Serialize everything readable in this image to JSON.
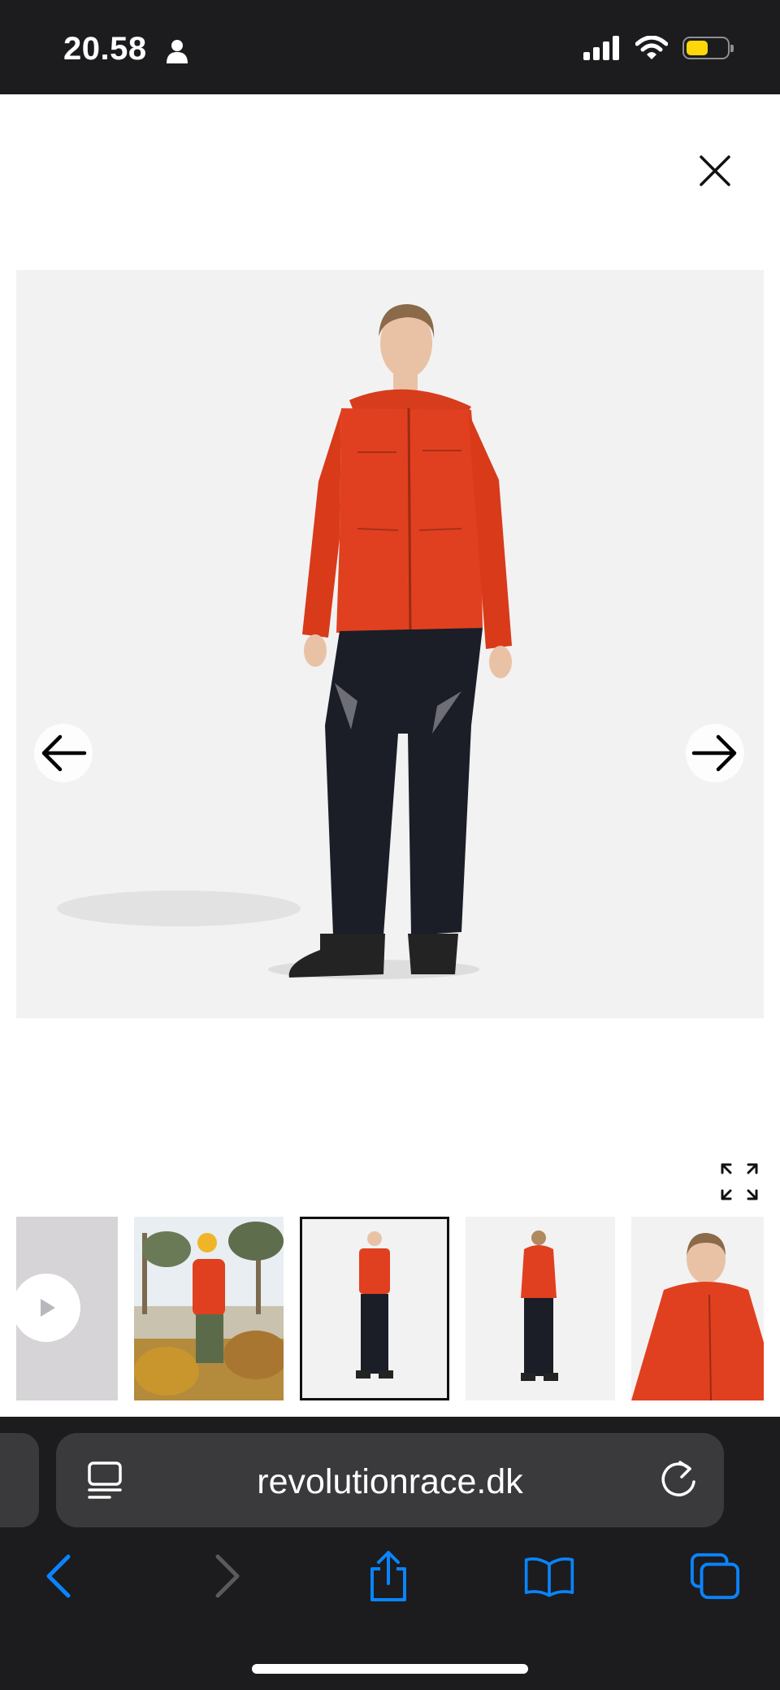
{
  "status_bar": {
    "time": "20.58",
    "icons": [
      "person-icon",
      "signal-icon",
      "wifi-icon",
      "battery-icon"
    ],
    "battery_color": "#ffd60a"
  },
  "gallery": {
    "close_icon": "close-icon",
    "prev_icon": "arrow-left-icon",
    "next_icon": "arrow-right-icon",
    "expand_icon": "expand-icon",
    "thumbnails": [
      {
        "kind": "video",
        "icon": "play-icon"
      },
      {
        "kind": "image",
        "description": "lifestyle"
      },
      {
        "kind": "image",
        "description": "front",
        "selected": true
      },
      {
        "kind": "image",
        "description": "back"
      },
      {
        "kind": "image",
        "description": "closeup"
      }
    ],
    "jacket_color": "#e0401f",
    "pants_color": "#1b1d27"
  },
  "browser": {
    "url": "revolutionrace.dk",
    "reader_icon": "reader-mode-icon",
    "reload_icon": "reload-icon",
    "toolbar": [
      "back-icon",
      "forward-icon",
      "share-icon",
      "bookmarks-icon",
      "tabs-icon"
    ],
    "accent_color": "#0a84ff"
  }
}
